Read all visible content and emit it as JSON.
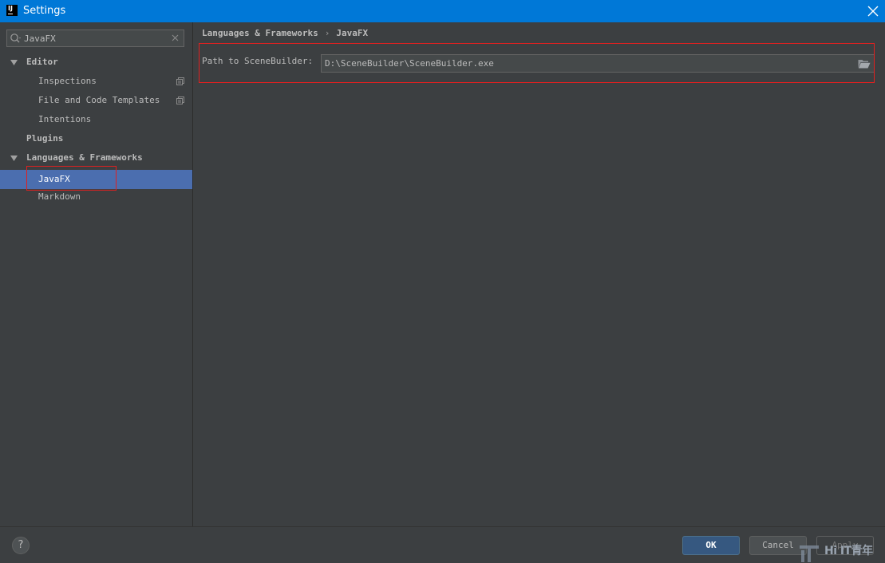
{
  "window": {
    "title": "Settings",
    "app_icon_label": "IJ"
  },
  "search": {
    "value": "JavaFX"
  },
  "tree": {
    "items": [
      {
        "label": "Editor"
      },
      {
        "label": "Inspections"
      },
      {
        "label": "File and Code Templates"
      },
      {
        "label": "Intentions"
      },
      {
        "label": "Plugins"
      },
      {
        "label": "Languages & Frameworks"
      },
      {
        "label": "JavaFX"
      },
      {
        "label": "Markdown"
      }
    ]
  },
  "breadcrumb": {
    "section": "Languages & Frameworks",
    "separator": "›",
    "page": "JavaFX"
  },
  "settings": {
    "path_label": "Path to SceneBuilder:",
    "path_value": "D:\\SceneBuilder\\SceneBuilder.exe"
  },
  "footer": {
    "help_label": "?",
    "ok_label": "OK",
    "cancel_label": "Cancel",
    "apply_label": "Apply"
  },
  "watermark": {
    "text": "Hi IT青年"
  },
  "colors": {
    "titlebar": "#0078d7",
    "background": "#3c3f41",
    "selection": "#4b6eaf",
    "highlight_box": "#e02020",
    "ok_button": "#365880"
  }
}
